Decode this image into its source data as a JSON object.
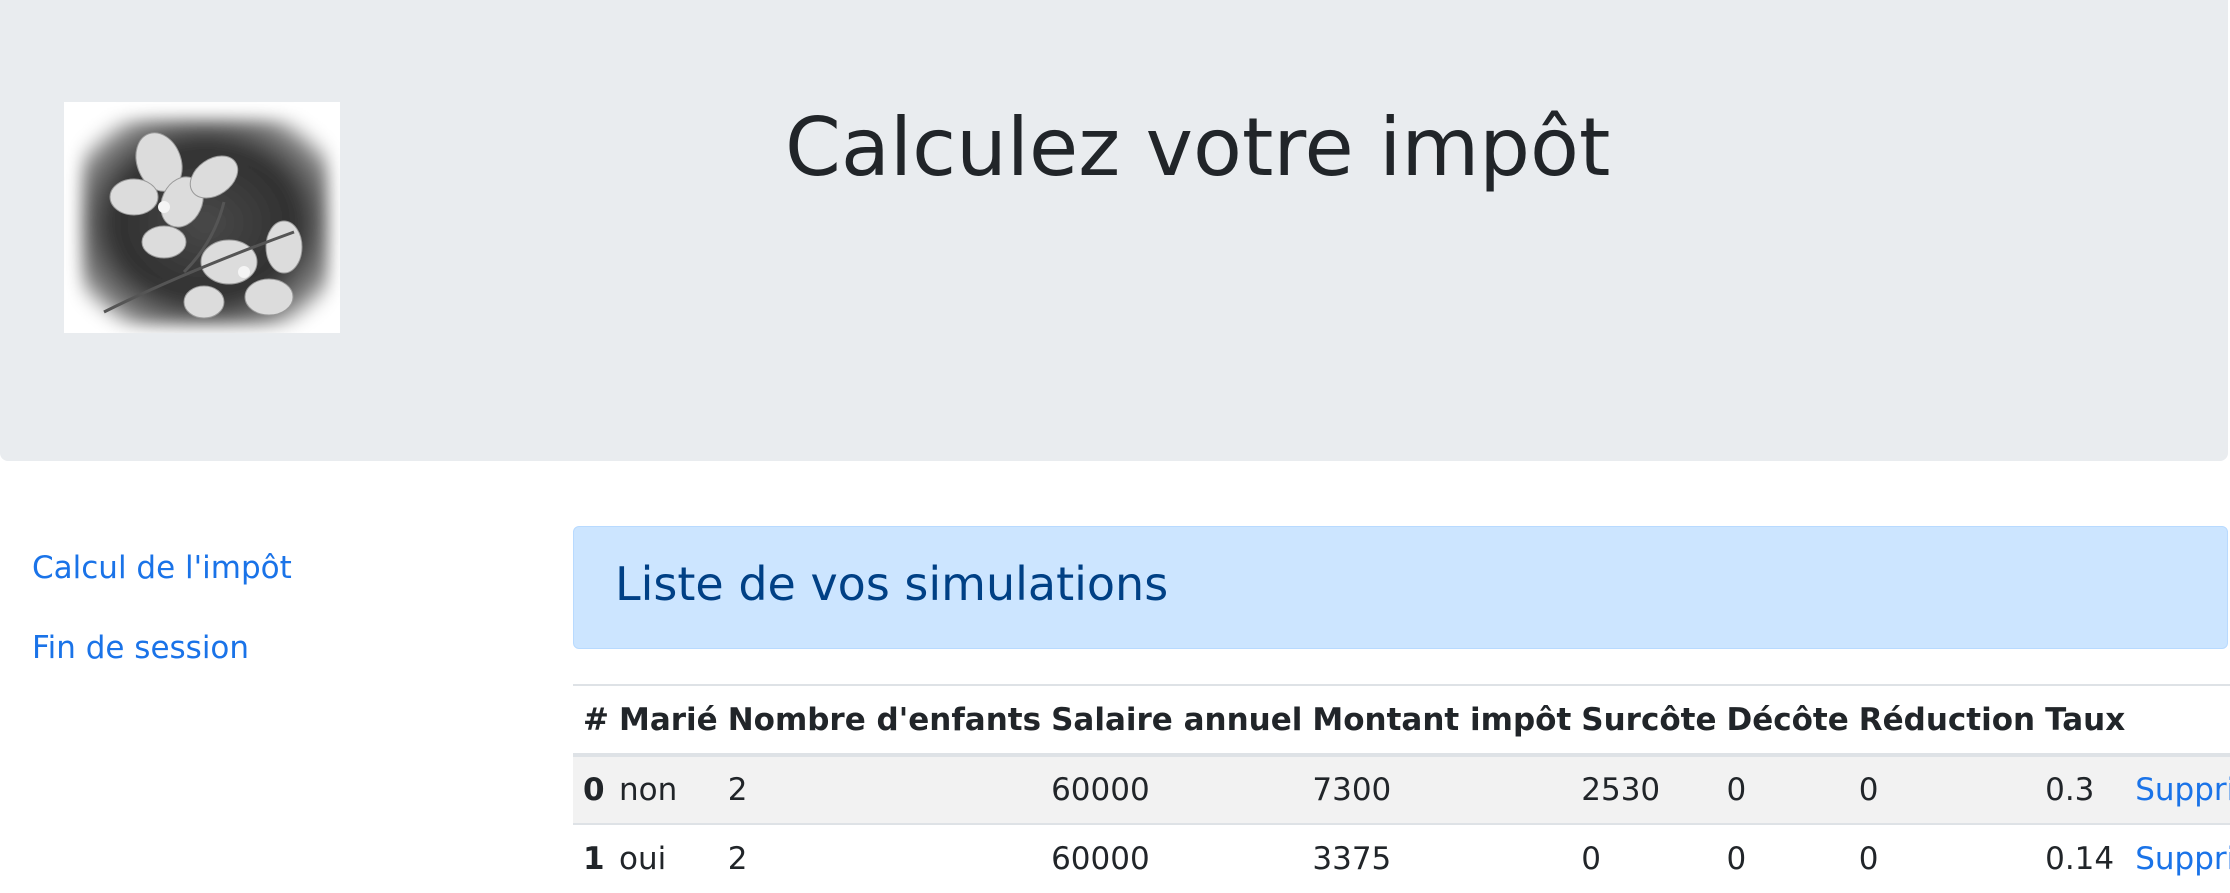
{
  "header": {
    "title": "Calculez votre impôt"
  },
  "nav": {
    "items": [
      {
        "label": "Calcul de l'impôt"
      },
      {
        "label": "Fin de session"
      }
    ]
  },
  "simulations": {
    "heading": "Liste de vos simulations",
    "columns": [
      "#",
      "Marié",
      "Nombre d'enfants",
      "Salaire annuel",
      "Montant impôt",
      "Surcôte",
      "Décôte",
      "Réduction",
      "Taux",
      ""
    ],
    "rows": [
      {
        "id": "0",
        "marie": "non",
        "enfants": "2",
        "salaire": "60000",
        "impot": "7300",
        "surcote": "2530",
        "decote": "0",
        "reduction": "0",
        "taux": "0.3",
        "action": "Supprimer"
      },
      {
        "id": "1",
        "marie": "oui",
        "enfants": "2",
        "salaire": "60000",
        "impot": "3375",
        "surcote": "0",
        "decote": "0",
        "reduction": "0",
        "taux": "0.14",
        "action": "Supprimer"
      }
    ]
  },
  "colors": {
    "jumbotron": "#e9ecef",
    "link": "#1a73e8",
    "alert_bg": "#cce5ff",
    "alert_text": "#004085"
  }
}
